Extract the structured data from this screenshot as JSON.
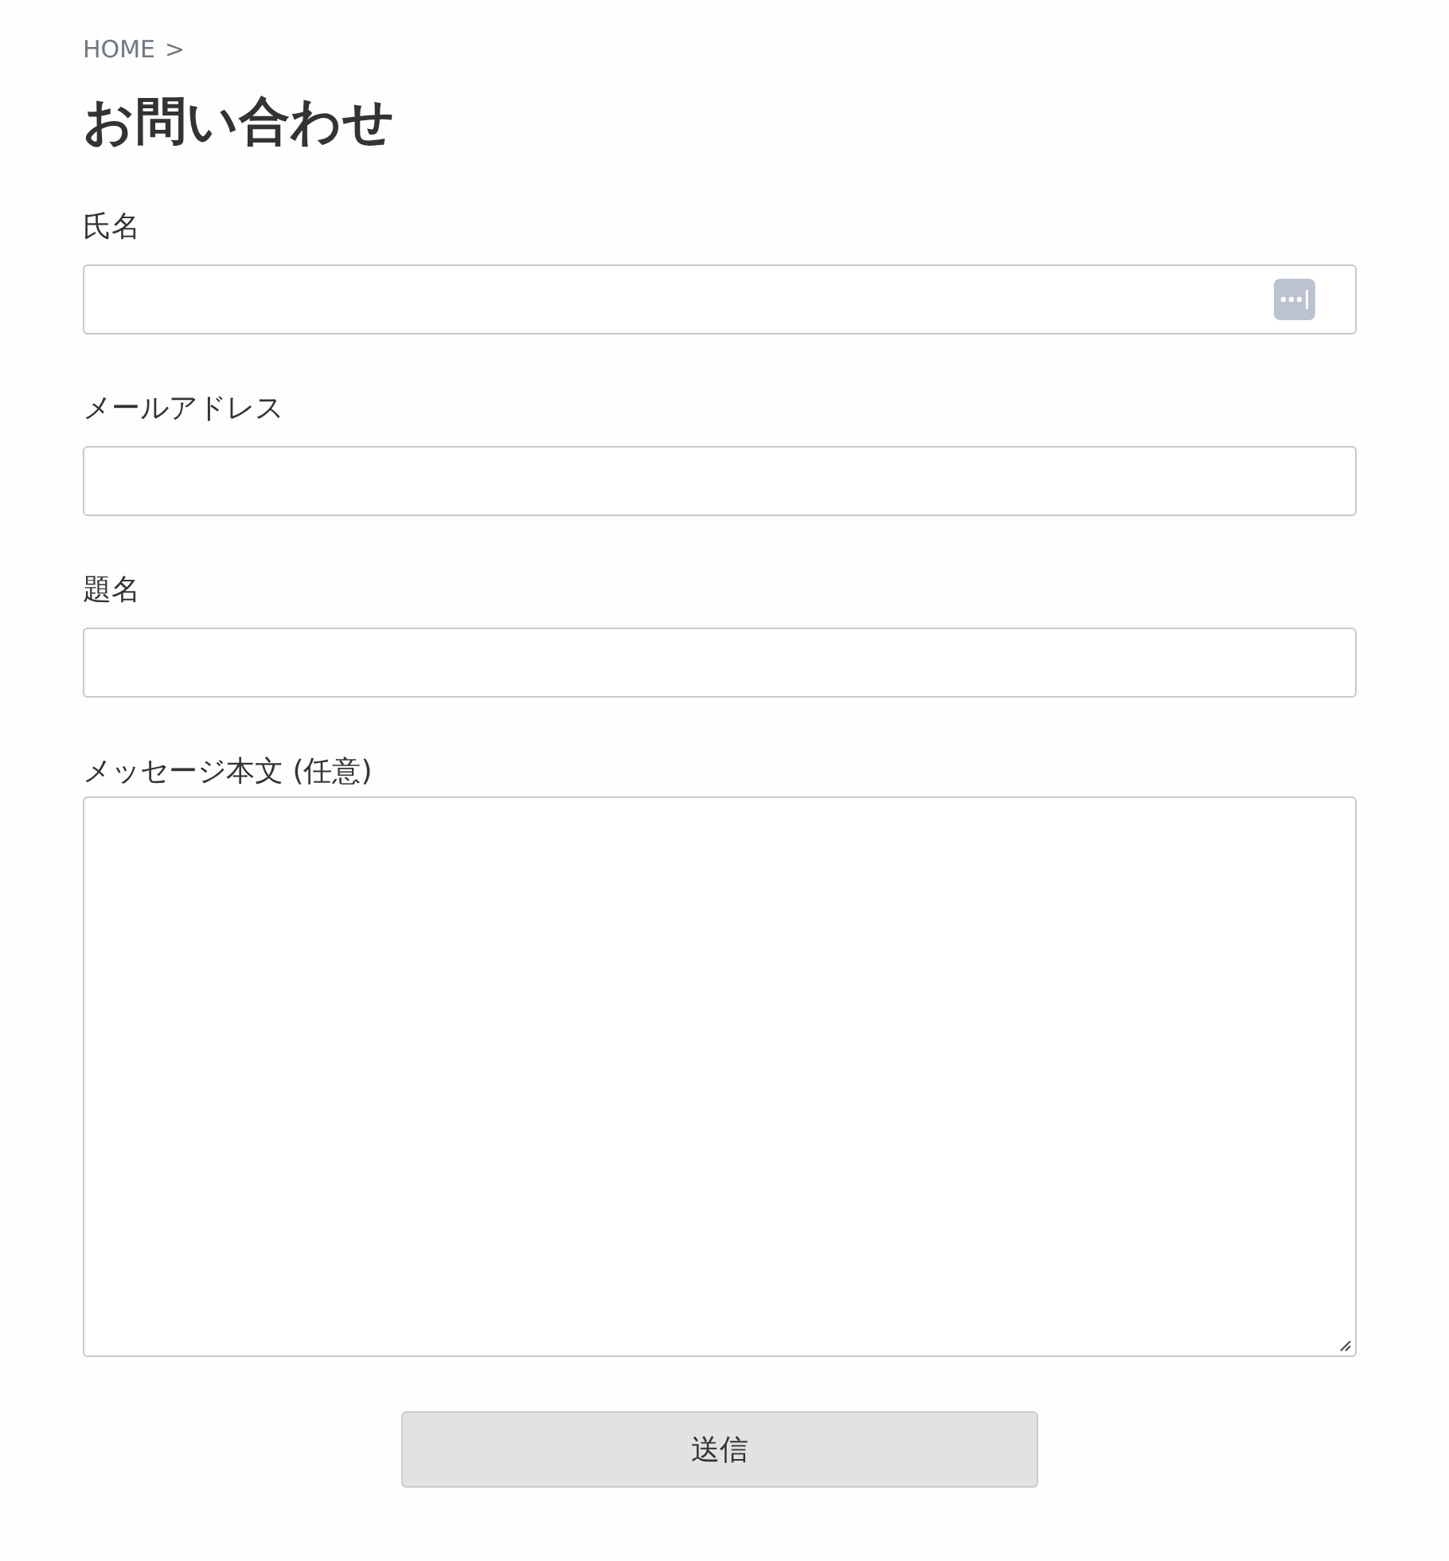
{
  "breadcrumb": {
    "items": [
      "HOME"
    ],
    "separator": ">"
  },
  "title": "お問い合わせ",
  "fields": [
    {
      "label": "氏名",
      "kind": "input",
      "autofill_icon": true
    },
    {
      "label": "メールアドレス",
      "kind": "input",
      "autofill_icon": false
    },
    {
      "label": "題名",
      "kind": "input",
      "autofill_icon": false
    },
    {
      "label": "メッセージ本文 (任意)",
      "kind": "textarea",
      "autofill_icon": false
    }
  ],
  "submit_button": "送信"
}
